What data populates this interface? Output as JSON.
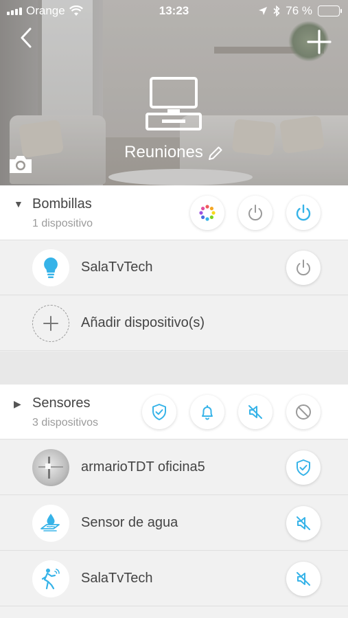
{
  "status_bar": {
    "carrier": "Orange",
    "time": "13:23",
    "battery_percent": "76 %",
    "battery_level": 0.76
  },
  "header": {
    "room_name": "Reuniones",
    "icons": [
      "back-icon",
      "add-icon",
      "tv-icon",
      "edit-icon",
      "camera-icon"
    ]
  },
  "groups": {
    "bulbs": {
      "title": "Bombillas",
      "count": "1 dispositivo",
      "expanded": true,
      "actions": [
        "color-wheel-icon",
        "power-off-icon",
        "power-on-icon"
      ]
    },
    "sensors": {
      "title": "Sensores",
      "count": "3 dispositivos",
      "expanded": false,
      "actions": [
        "shield-icon",
        "bell-icon",
        "mute-icon",
        "block-icon"
      ]
    }
  },
  "bulb_devices": [
    {
      "name": "SalaTvTech",
      "icon": "bulb-icon",
      "action": "power-icon"
    }
  ],
  "add_device": {
    "label": "Añadir dispositivo(s)",
    "icon": "plus-icon"
  },
  "sensor_devices": [
    {
      "name": "armarioTDT oficina5",
      "icon": "door-sensor-photo",
      "action": "shield-icon"
    },
    {
      "name": "Sensor de agua",
      "icon": "water-sensor-icon",
      "action": "mute-icon"
    },
    {
      "name": "SalaTvTech",
      "icon": "motion-sensor-icon",
      "action": "mute-icon"
    }
  ],
  "colors": {
    "accent_blue": "#36b3e8",
    "icon_gray": "#8a8a8a",
    "group_bg": "#ffffff",
    "item_bg": "#f1f1f1"
  }
}
